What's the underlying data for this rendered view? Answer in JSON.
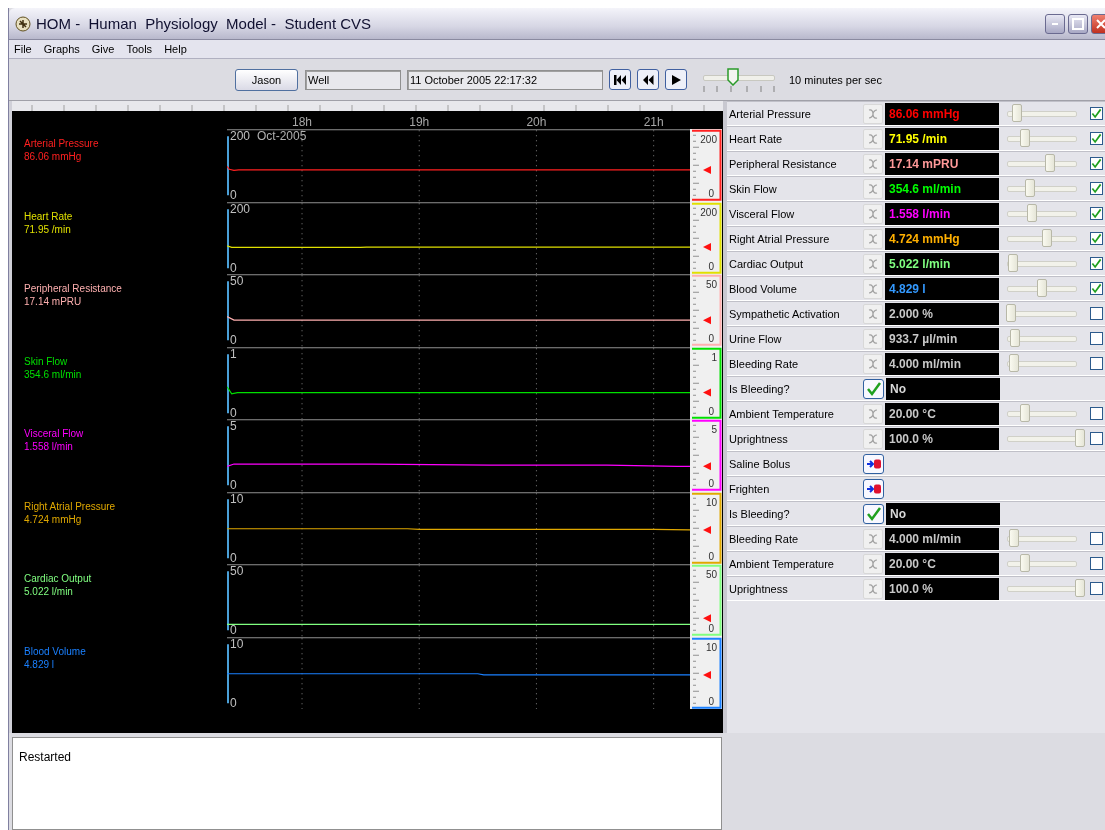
{
  "window": {
    "title": "HOM -  Human  Physiology  Model -  Student CVS"
  },
  "menu": [
    "File",
    "Graphs",
    "Give",
    "Tools",
    "Help"
  ],
  "toolbar": {
    "patient_button": "Jason",
    "status_field": "Well",
    "time_field": "11 October 2005 22:17:32",
    "speed": {
      "level": 0.4,
      "label": "10 minutes per sec"
    }
  },
  "traces": [
    {
      "reading": "86.06 mmHg",
      "scale_labels": [
        "200",
        "0"
      ],
      "chart_data": {
        "type": "line",
        "x": [
          17.36,
          17.38,
          17.42,
          17.46,
          21.31
        ],
        "xlim": [
          17.36,
          21.31
        ],
        "xticks": [
          {
            "value": 18,
            "label": "18h"
          },
          {
            "value": 19,
            "label": "19h"
          },
          {
            "value": 20,
            "label": "20h"
          },
          {
            "value": 21,
            "label": "21h"
          }
        ],
        "ylim": [
          0,
          200
        ],
        "yticks": [
          0,
          200
        ],
        "annotations": [
          {
            "text": "Oct-2005"
          }
        ],
        "grid": true,
        "series": [
          {
            "name": "Arterial Pressure",
            "color": "#ff2020",
            "values": [
              98,
              88,
              84,
              86,
              86
            ]
          }
        ]
      }
    },
    {
      "reading": "71.95 /min",
      "scale_labels": [
        "200",
        "0"
      ],
      "chart_data": {
        "type": "line",
        "x": [
          17.36,
          17.4,
          18.5,
          18.55,
          21.31
        ],
        "xlim": [
          17.36,
          21.31
        ],
        "ylim": [
          0,
          200
        ],
        "yticks": [
          0,
          200
        ],
        "grid": true,
        "series": [
          {
            "name": "Heart Rate",
            "color": "#e0e000",
            "values": [
              76,
              71,
              71,
              72,
              72
            ]
          }
        ]
      }
    },
    {
      "reading": "17.14 mPRU",
      "scale_labels": [
        "50",
        "0"
      ],
      "chart_data": {
        "type": "line",
        "x": [
          17.36,
          17.42,
          21.31
        ],
        "xlim": [
          17.36,
          21.31
        ],
        "ylim": [
          0,
          50
        ],
        "yticks": [
          0,
          50
        ],
        "grid": true,
        "series": [
          {
            "name": "Peripheral Resistance",
            "color": "#ffb0b0",
            "values": [
              20,
              17,
              17
            ]
          }
        ]
      }
    },
    {
      "reading": "354.6 ml/min",
      "scale_labels": [
        "1",
        "0"
      ],
      "chart_data": {
        "type": "line",
        "x": [
          17.36,
          17.4,
          17.45,
          21.31
        ],
        "xlim": [
          17.36,
          21.31
        ],
        "ylim": [
          0,
          1
        ],
        "yticks": [
          0,
          1
        ],
        "grid": true,
        "series": [
          {
            "name": "Skin Flow",
            "color": "#00e000",
            "values": [
              0.45,
              0.33,
              0.35,
              0.35
            ]
          }
        ]
      }
    },
    {
      "reading": "1.558 l/min",
      "scale_labels": [
        "5",
        "0"
      ],
      "chart_data": {
        "type": "line",
        "x": [
          17.36,
          17.42,
          18.6,
          19.6,
          20.6,
          21.2,
          21.31
        ],
        "xlim": [
          17.36,
          21.31
        ],
        "ylim": [
          0,
          5
        ],
        "yticks": [
          0,
          5
        ],
        "grid": true,
        "series": [
          {
            "name": "Visceral Flow",
            "color": "#ff00ff",
            "values": [
              1.6,
              1.8,
              1.8,
              1.7,
              1.7,
              1.6,
              1.6
            ]
          }
        ]
      }
    },
    {
      "reading": "4.724 mmHg",
      "scale_labels": [
        "10",
        "0"
      ],
      "chart_data": {
        "type": "line",
        "x": [
          17.36,
          18.9,
          19.0,
          21.0,
          21.31
        ],
        "xlim": [
          17.36,
          21.31
        ],
        "ylim": [
          0,
          10
        ],
        "yticks": [
          0,
          10
        ],
        "grid": true,
        "series": [
          {
            "name": "Right Atrial Pressure",
            "color": "#e0a800",
            "values": [
              5.0,
              5.0,
              4.9,
              4.9,
              4.8
            ]
          }
        ]
      }
    },
    {
      "reading": "5.022 l/min",
      "scale_labels": [
        "50",
        "0"
      ],
      "chart_data": {
        "type": "line",
        "x": [
          17.36,
          21.31
        ],
        "xlim": [
          17.36,
          21.31
        ],
        "ylim": [
          0,
          50
        ],
        "yticks": [
          0,
          50
        ],
        "grid": true,
        "series": [
          {
            "name": "Cardiac Output",
            "color": "#80ff80",
            "values": [
              5,
              5
            ]
          }
        ]
      }
    },
    {
      "reading": "4.829 l",
      "scale_labels": [
        "10",
        "0"
      ],
      "chart_data": {
        "type": "line",
        "x": [
          17.36,
          19.5,
          19.55,
          21.31
        ],
        "xlim": [
          17.36,
          21.31
        ],
        "ylim": [
          0,
          10
        ],
        "yticks": [
          0,
          10
        ],
        "grid": true,
        "series": [
          {
            "name": "Blood Volume",
            "color": "#1a80ff",
            "values": [
              5.0,
              5.0,
              4.8,
              4.8
            ]
          }
        ]
      }
    }
  ],
  "parameters": [
    {
      "kind": "variable",
      "name": "Arterial Pressure",
      "value": "86.06 mmHg",
      "color": "#ff0000",
      "level": 0.1,
      "checked": true
    },
    {
      "kind": "variable",
      "name": "Heart Rate",
      "value": "71.95 /min",
      "color": "#ffff00",
      "level": 0.22,
      "checked": true
    },
    {
      "kind": "variable",
      "name": "Peripheral Resistance",
      "value": "17.14 mPRU",
      "color": "#ff9999",
      "level": 0.57,
      "checked": true
    },
    {
      "kind": "variable",
      "name": "Skin Flow",
      "value": "354.6 ml/min",
      "color": "#00ff00",
      "level": 0.29,
      "checked": true
    },
    {
      "kind": "variable",
      "name": "Visceral Flow",
      "value": "1.558 l/min",
      "color": "#ff00ff",
      "level": 0.31,
      "checked": true
    },
    {
      "kind": "variable",
      "name": "Right Atrial Pressure",
      "value": "4.724 mmHg",
      "color": "#ffb000",
      "level": 0.53,
      "checked": true
    },
    {
      "kind": "variable",
      "name": "Cardiac Output",
      "value": "5.022 l/min",
      "color": "#80ff80",
      "level": 0.04,
      "checked": true
    },
    {
      "kind": "variable",
      "name": "Blood Volume",
      "value": "4.829 l",
      "color": "#3399ff",
      "level": 0.46,
      "checked": true
    },
    {
      "kind": "variable",
      "name": "Sympathetic Activation",
      "value": "2.000 %",
      "color": "#c8c8c8",
      "level": 0.01,
      "checked": false
    },
    {
      "kind": "variable",
      "name": "Urine Flow",
      "value": "933.7 µl/min",
      "color": "#c8c8c8",
      "level": 0.07,
      "checked": false
    },
    {
      "kind": "variable",
      "name": "Bleeding Rate",
      "value": "4.000 ml/min",
      "color": "#c8c8c8",
      "level": 0.05,
      "checked": false
    },
    {
      "kind": "toggle",
      "name": "Is Bleeding?",
      "value": "No"
    },
    {
      "kind": "variable",
      "name": "Ambient Temperature",
      "value": "20.00 °C",
      "color": "#c8c8c8",
      "level": 0.21,
      "checked": false
    },
    {
      "kind": "variable",
      "name": "Uprightness",
      "value": "100.0 %",
      "color": "#c8c8c8",
      "level": 1.0,
      "checked": false
    },
    {
      "kind": "action",
      "name": "Saline Bolus"
    },
    {
      "kind": "action",
      "name": "Frighten"
    },
    {
      "kind": "toggle",
      "name": "Is Bleeding?",
      "value": "No"
    },
    {
      "kind": "variable",
      "name": "Bleeding Rate",
      "value": "4.000 ml/min",
      "color": "#c8c8c8",
      "level": 0.05,
      "checked": false
    },
    {
      "kind": "variable",
      "name": "Ambient Temperature",
      "value": "20.00 °C",
      "color": "#c8c8c8",
      "level": 0.21,
      "checked": false
    },
    {
      "kind": "variable",
      "name": "Uprightness",
      "value": "100.0 %",
      "color": "#c8c8c8",
      "level": 1.0,
      "checked": false
    }
  ],
  "log": {
    "lines": [
      "Restarted"
    ]
  }
}
